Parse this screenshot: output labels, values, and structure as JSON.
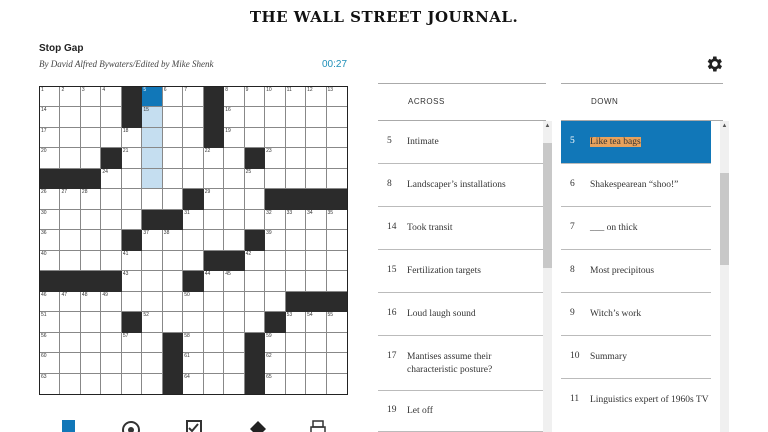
{
  "masthead": "THE WALL STREET JOURNAL.",
  "puzzle": {
    "title": "Stop Gap",
    "byline": "By David Alfred Bywaters/Edited by Mike Shenk",
    "timer": "00:27"
  },
  "icons": {
    "settings": "gear-icon"
  },
  "colors": {
    "selected_cell": "#1177b8",
    "word_highlight": "#c5def0",
    "clue_highlight": "#e8a25c",
    "timer": "#1f8fb8"
  },
  "across": {
    "header": "ACROSS",
    "clues": [
      {
        "num": "5",
        "text": "Intimate"
      },
      {
        "num": "8",
        "text": "Landscaper’s installations"
      },
      {
        "num": "14",
        "text": "Took transit"
      },
      {
        "num": "15",
        "text": "Fertilization targets"
      },
      {
        "num": "16",
        "text": "Loud laugh sound"
      },
      {
        "num": "17",
        "text": "Mantises assume their characteristic posture?"
      },
      {
        "num": "19",
        "text": "Let off"
      }
    ]
  },
  "down": {
    "header": "DOWN",
    "clues": [
      {
        "num": "5",
        "text": "Like tea bags"
      },
      {
        "num": "6",
        "text": "Shakespearean “shoo!”"
      },
      {
        "num": "7",
        "text": "___ on thick"
      },
      {
        "num": "8",
        "text": "Most precipitous"
      },
      {
        "num": "9",
        "text": "Witch’s work"
      },
      {
        "num": "10",
        "text": "Summary"
      },
      {
        "num": "11",
        "text": "Linguistics expert of 1960s TV"
      }
    ]
  },
  "grid": {
    "size": 15,
    "blacks": [
      [
        0,
        4
      ],
      [
        0,
        8
      ],
      [
        1,
        4
      ],
      [
        1,
        8
      ],
      [
        2,
        8
      ],
      [
        3,
        3
      ],
      [
        3,
        10
      ],
      [
        4,
        0
      ],
      [
        4,
        1
      ],
      [
        4,
        2
      ],
      [
        5,
        7
      ],
      [
        5,
        11
      ],
      [
        5,
        12
      ],
      [
        5,
        13
      ],
      [
        5,
        14
      ],
      [
        6,
        5
      ],
      [
        6,
        6
      ],
      [
        7,
        4
      ],
      [
        7,
        10
      ],
      [
        8,
        8
      ],
      [
        8,
        9
      ],
      [
        9,
        0
      ],
      [
        9,
        1
      ],
      [
        9,
        2
      ],
      [
        9,
        3
      ],
      [
        9,
        7
      ],
      [
        10,
        12
      ],
      [
        10,
        13
      ],
      [
        10,
        14
      ],
      [
        11,
        4
      ],
      [
        11,
        11
      ],
      [
        12,
        6
      ],
      [
        12,
        10
      ],
      [
        13,
        6
      ],
      [
        13,
        10
      ],
      [
        14,
        6
      ],
      [
        14,
        10
      ]
    ],
    "selected": [
      0,
      5
    ],
    "word": [
      [
        1,
        5
      ],
      [
        2,
        5
      ],
      [
        3,
        5
      ],
      [
        4,
        5
      ]
    ],
    "numbers": [
      [
        0,
        0,
        "1"
      ],
      [
        0,
        1,
        "2"
      ],
      [
        0,
        2,
        "3"
      ],
      [
        0,
        3,
        "4"
      ],
      [
        0,
        5,
        "5"
      ],
      [
        0,
        6,
        "6"
      ],
      [
        0,
        7,
        "7"
      ],
      [
        0,
        9,
        "8"
      ],
      [
        0,
        10,
        "9"
      ],
      [
        0,
        11,
        "10"
      ],
      [
        0,
        12,
        "11"
      ],
      [
        0,
        13,
        "12"
      ],
      [
        0,
        14,
        "13"
      ],
      [
        1,
        0,
        "14"
      ],
      [
        1,
        5,
        "15"
      ],
      [
        1,
        9,
        "16"
      ],
      [
        2,
        0,
        "17"
      ],
      [
        2,
        4,
        "18"
      ],
      [
        2,
        9,
        "19"
      ],
      [
        3,
        0,
        "20"
      ],
      [
        3,
        4,
        "21"
      ],
      [
        3,
        8,
        "22"
      ],
      [
        3,
        11,
        "23"
      ],
      [
        4,
        3,
        "24"
      ],
      [
        4,
        10,
        "25"
      ],
      [
        5,
        0,
        "26"
      ],
      [
        5,
        1,
        "27"
      ],
      [
        5,
        2,
        "28"
      ],
      [
        5,
        8,
        "29"
      ],
      [
        6,
        0,
        "30"
      ],
      [
        6,
        7,
        "31"
      ],
      [
        6,
        11,
        "32"
      ],
      [
        6,
        12,
        "33"
      ],
      [
        6,
        13,
        "34"
      ],
      [
        6,
        14,
        "35"
      ],
      [
        7,
        0,
        "36"
      ],
      [
        7,
        5,
        "37"
      ],
      [
        7,
        6,
        "38"
      ],
      [
        7,
        11,
        "39"
      ],
      [
        8,
        0,
        "40"
      ],
      [
        8,
        4,
        "41"
      ],
      [
        8,
        10,
        "42"
      ],
      [
        9,
        4,
        "43"
      ],
      [
        9,
        8,
        "44"
      ],
      [
        9,
        9,
        "45"
      ],
      [
        10,
        0,
        "46"
      ],
      [
        10,
        1,
        "47"
      ],
      [
        10,
        2,
        "48"
      ],
      [
        10,
        3,
        "49"
      ],
      [
        10,
        7,
        "50"
      ],
      [
        11,
        0,
        "51"
      ],
      [
        11,
        5,
        "52"
      ],
      [
        11,
        12,
        "53"
      ],
      [
        11,
        13,
        "54"
      ],
      [
        11,
        14,
        "55"
      ],
      [
        12,
        0,
        "56"
      ],
      [
        12,
        4,
        "57"
      ],
      [
        12,
        7,
        "58"
      ],
      [
        12,
        11,
        "59"
      ],
      [
        13,
        0,
        "60"
      ],
      [
        13,
        7,
        "61"
      ],
      [
        13,
        11,
        "62"
      ],
      [
        14,
        0,
        "63"
      ],
      [
        14,
        7,
        "64"
      ],
      [
        14,
        11,
        "65"
      ]
    ]
  },
  "toolbar": [
    "pencil-icon",
    "target-icon",
    "check-icon",
    "diamond-icon",
    "print-icon"
  ]
}
